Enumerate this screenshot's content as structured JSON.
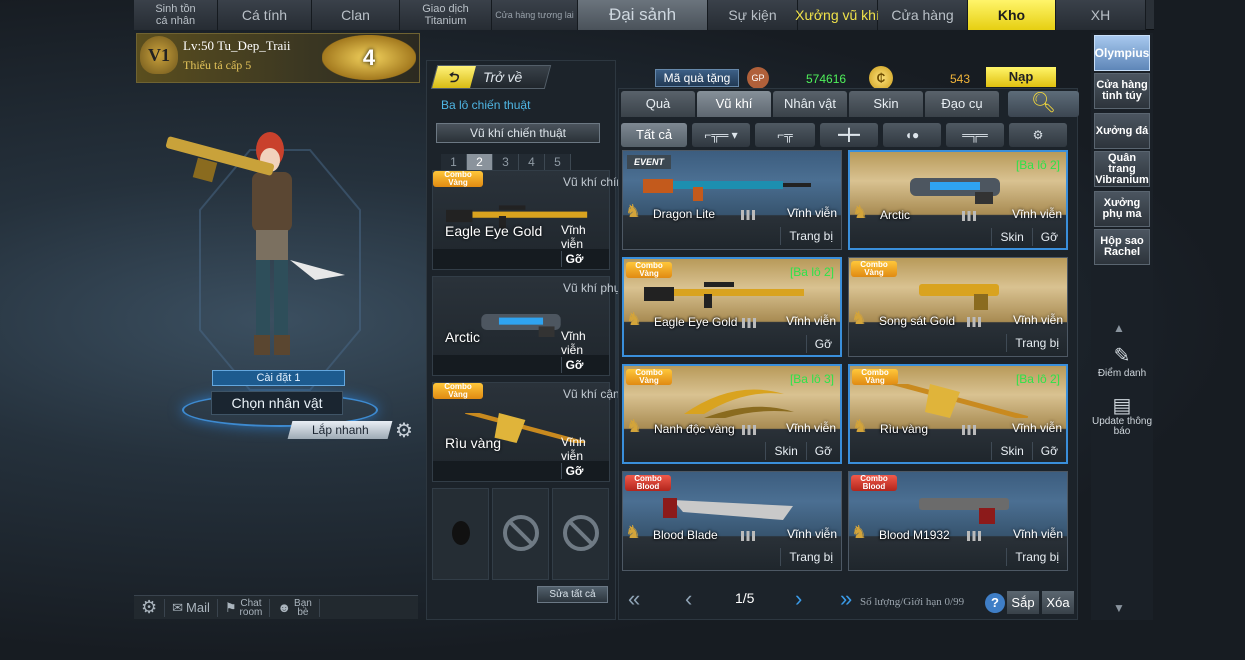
{
  "topnav": [
    {
      "label": "Sinh tồn\ncá nhân",
      "cls": "small",
      "w": 84
    },
    {
      "label": "Cá tính",
      "cls": "",
      "w": 94
    },
    {
      "label": "Clan",
      "cls": "",
      "w": 88
    },
    {
      "label": "Giao dịch\nTitanium",
      "cls": "small",
      "w": 92
    },
    {
      "label": "Cửa hàng tương lai",
      "cls": "tiny",
      "w": 86
    },
    {
      "label": "Đại sảnh",
      "cls": "active",
      "w": 130
    },
    {
      "label": "Sự kiện",
      "cls": "",
      "w": 90
    },
    {
      "label": "Xưởng vũ khí",
      "cls": "yellow",
      "w": 80
    },
    {
      "label": "Cửa hàng",
      "cls": "",
      "w": 90
    },
    {
      "label": "Kho",
      "cls": "kho",
      "w": 88
    },
    {
      "label": "XH",
      "cls": "",
      "w": 90
    }
  ],
  "profile": {
    "rank_icon": "V1",
    "level_text": "Lv:50 Tu_Dep_Traii",
    "rank_name": "Thiếu tá cấp 5",
    "medal": "4"
  },
  "character": {
    "setting_label": "Cài đặt 1",
    "choose_label": "Chọn nhân vật",
    "quick_label": "Lắp nhanh"
  },
  "bottombar": {
    "mail": "Mail",
    "chat": "Chat\nroom",
    "friends": "Bạn\nbè"
  },
  "middle": {
    "back_label": "Trở về",
    "balo_label": "Ba lô chiến thuật",
    "tactical_weapon_label": "Vũ khí chiến thuật",
    "pages": [
      "1",
      "2",
      "3",
      "4",
      "5"
    ],
    "active_page": 1,
    "slots": [
      {
        "badge": "Combo\nVàng",
        "category": "Vũ khí chính",
        "name": "Eagle Eye Gold",
        "perm": "Vĩnh viễn",
        "action": "Gỡ"
      },
      {
        "badge": "",
        "category": "Vũ khí phụ",
        "name": "Arctic",
        "perm": "Vĩnh viễn",
        "action": "Gỡ"
      },
      {
        "badge": "Combo\nVàng",
        "category": "Vũ khí cận chiến",
        "name": "Rìu vàng",
        "perm": "Vĩnh viễn",
        "action": "Gỡ"
      }
    ],
    "edit_all_label": "Sửa tất cả"
  },
  "currency": {
    "gift_code_label": "Mã quà tặng",
    "gp_icon": "GP",
    "gp_value": "574616",
    "coin_value": "543",
    "topup_label": "Nạp",
    "coin_color": "#f0b43a",
    "gp_color": "#4ff05a"
  },
  "categories": [
    {
      "label": "Quà",
      "w": 74
    },
    {
      "label": "Vũ khí",
      "w": 74
    },
    {
      "label": "Nhân vật",
      "w": 74
    },
    {
      "label": "Skin",
      "w": 74
    },
    {
      "label": "Đạo cụ",
      "w": 74
    }
  ],
  "active_category": 1,
  "subtabs": [
    {
      "label": "Tất cả",
      "w": 66
    },
    {
      "label": "⌐╦═ ▾",
      "w": 58
    },
    {
      "label": "⌐╦",
      "w": 60
    },
    {
      "label": "━╋━",
      "w": 58
    },
    {
      "label": "◖●",
      "w": 58
    },
    {
      "label": "═╦═",
      "w": 58
    },
    {
      "label": "⚙",
      "w": 58
    }
  ],
  "items": [
    {
      "name": "Dragon Lite",
      "perm": "Vĩnh viễn",
      "badge": "",
      "event": "EVENT",
      "tag": "",
      "actions": [
        "Trang bị"
      ],
      "style": "blue",
      "selected": false,
      "weapon": "rifle-dragon"
    },
    {
      "name": "Arctic",
      "perm": "Vĩnh viễn",
      "badge": "",
      "event": "",
      "tag": "[Ba lô 2]",
      "actions": [
        "Skin",
        "Gỡ"
      ],
      "style": "gold",
      "selected": true,
      "weapon": "pistol-arctic"
    },
    {
      "name": "Eagle Eye Gold",
      "perm": "Vĩnh viễn",
      "badge": "Combo\nVàng",
      "event": "",
      "tag": "[Ba lô 2]",
      "actions": [
        "Gỡ"
      ],
      "style": "gold",
      "selected": true,
      "weapon": "rifle-gold"
    },
    {
      "name": "Song sát Gold",
      "perm": "Vĩnh viễn",
      "badge": "Combo\nVàng",
      "event": "",
      "tag": "",
      "actions": [
        "Trang bị"
      ],
      "style": "gold",
      "selected": false,
      "weapon": "pistol-gold"
    },
    {
      "name": "Nanh độc vàng",
      "perm": "Vĩnh viễn",
      "badge": "Combo\nVàng",
      "event": "",
      "tag": "[Ba lô 3]",
      "actions": [
        "Skin",
        "Gỡ"
      ],
      "style": "gold",
      "selected": true,
      "weapon": "claw"
    },
    {
      "name": "Rìu vàng",
      "perm": "Vĩnh viễn",
      "badge": "Combo\nVàng",
      "event": "",
      "tag": "[Ba lô 2]",
      "actions": [
        "Skin",
        "Gỡ"
      ],
      "style": "gold",
      "selected": true,
      "weapon": "axe"
    },
    {
      "name": "Blood Blade",
      "perm": "Vĩnh viễn",
      "badge": "Combo\nBlood",
      "event": "",
      "tag": "",
      "actions": [
        "Trang bị"
      ],
      "style": "blue",
      "selected": false,
      "weapon": "blade"
    },
    {
      "name": "Blood M1932",
      "perm": "Vĩnh viễn",
      "badge": "Combo\nBlood",
      "event": "",
      "tag": "",
      "actions": [
        "Trang bị"
      ],
      "style": "blue",
      "selected": false,
      "weapon": "pistol-red"
    }
  ],
  "pager": {
    "page": "1/5",
    "qty_label": "Số lượng/Giới hạn",
    "qty_value": "0/99",
    "help": "?",
    "sort_label": "Sắp xếp",
    "delete_label": "Xóa"
  },
  "sidebar": [
    {
      "label": "Olympius",
      "on": true
    },
    {
      "label": "Cửa hàng tinh túy",
      "on": false
    },
    {
      "label": "Xưởng đá",
      "on": false
    },
    {
      "label": "Quân trang Vibranium",
      "on": false
    },
    {
      "label": "Xưởng phụ ma",
      "on": false
    },
    {
      "label": "Hộp sao Rachel",
      "on": false
    }
  ],
  "sidebar_bottom": {
    "checkin": "Điểm danh",
    "update": "Update thông báo"
  }
}
